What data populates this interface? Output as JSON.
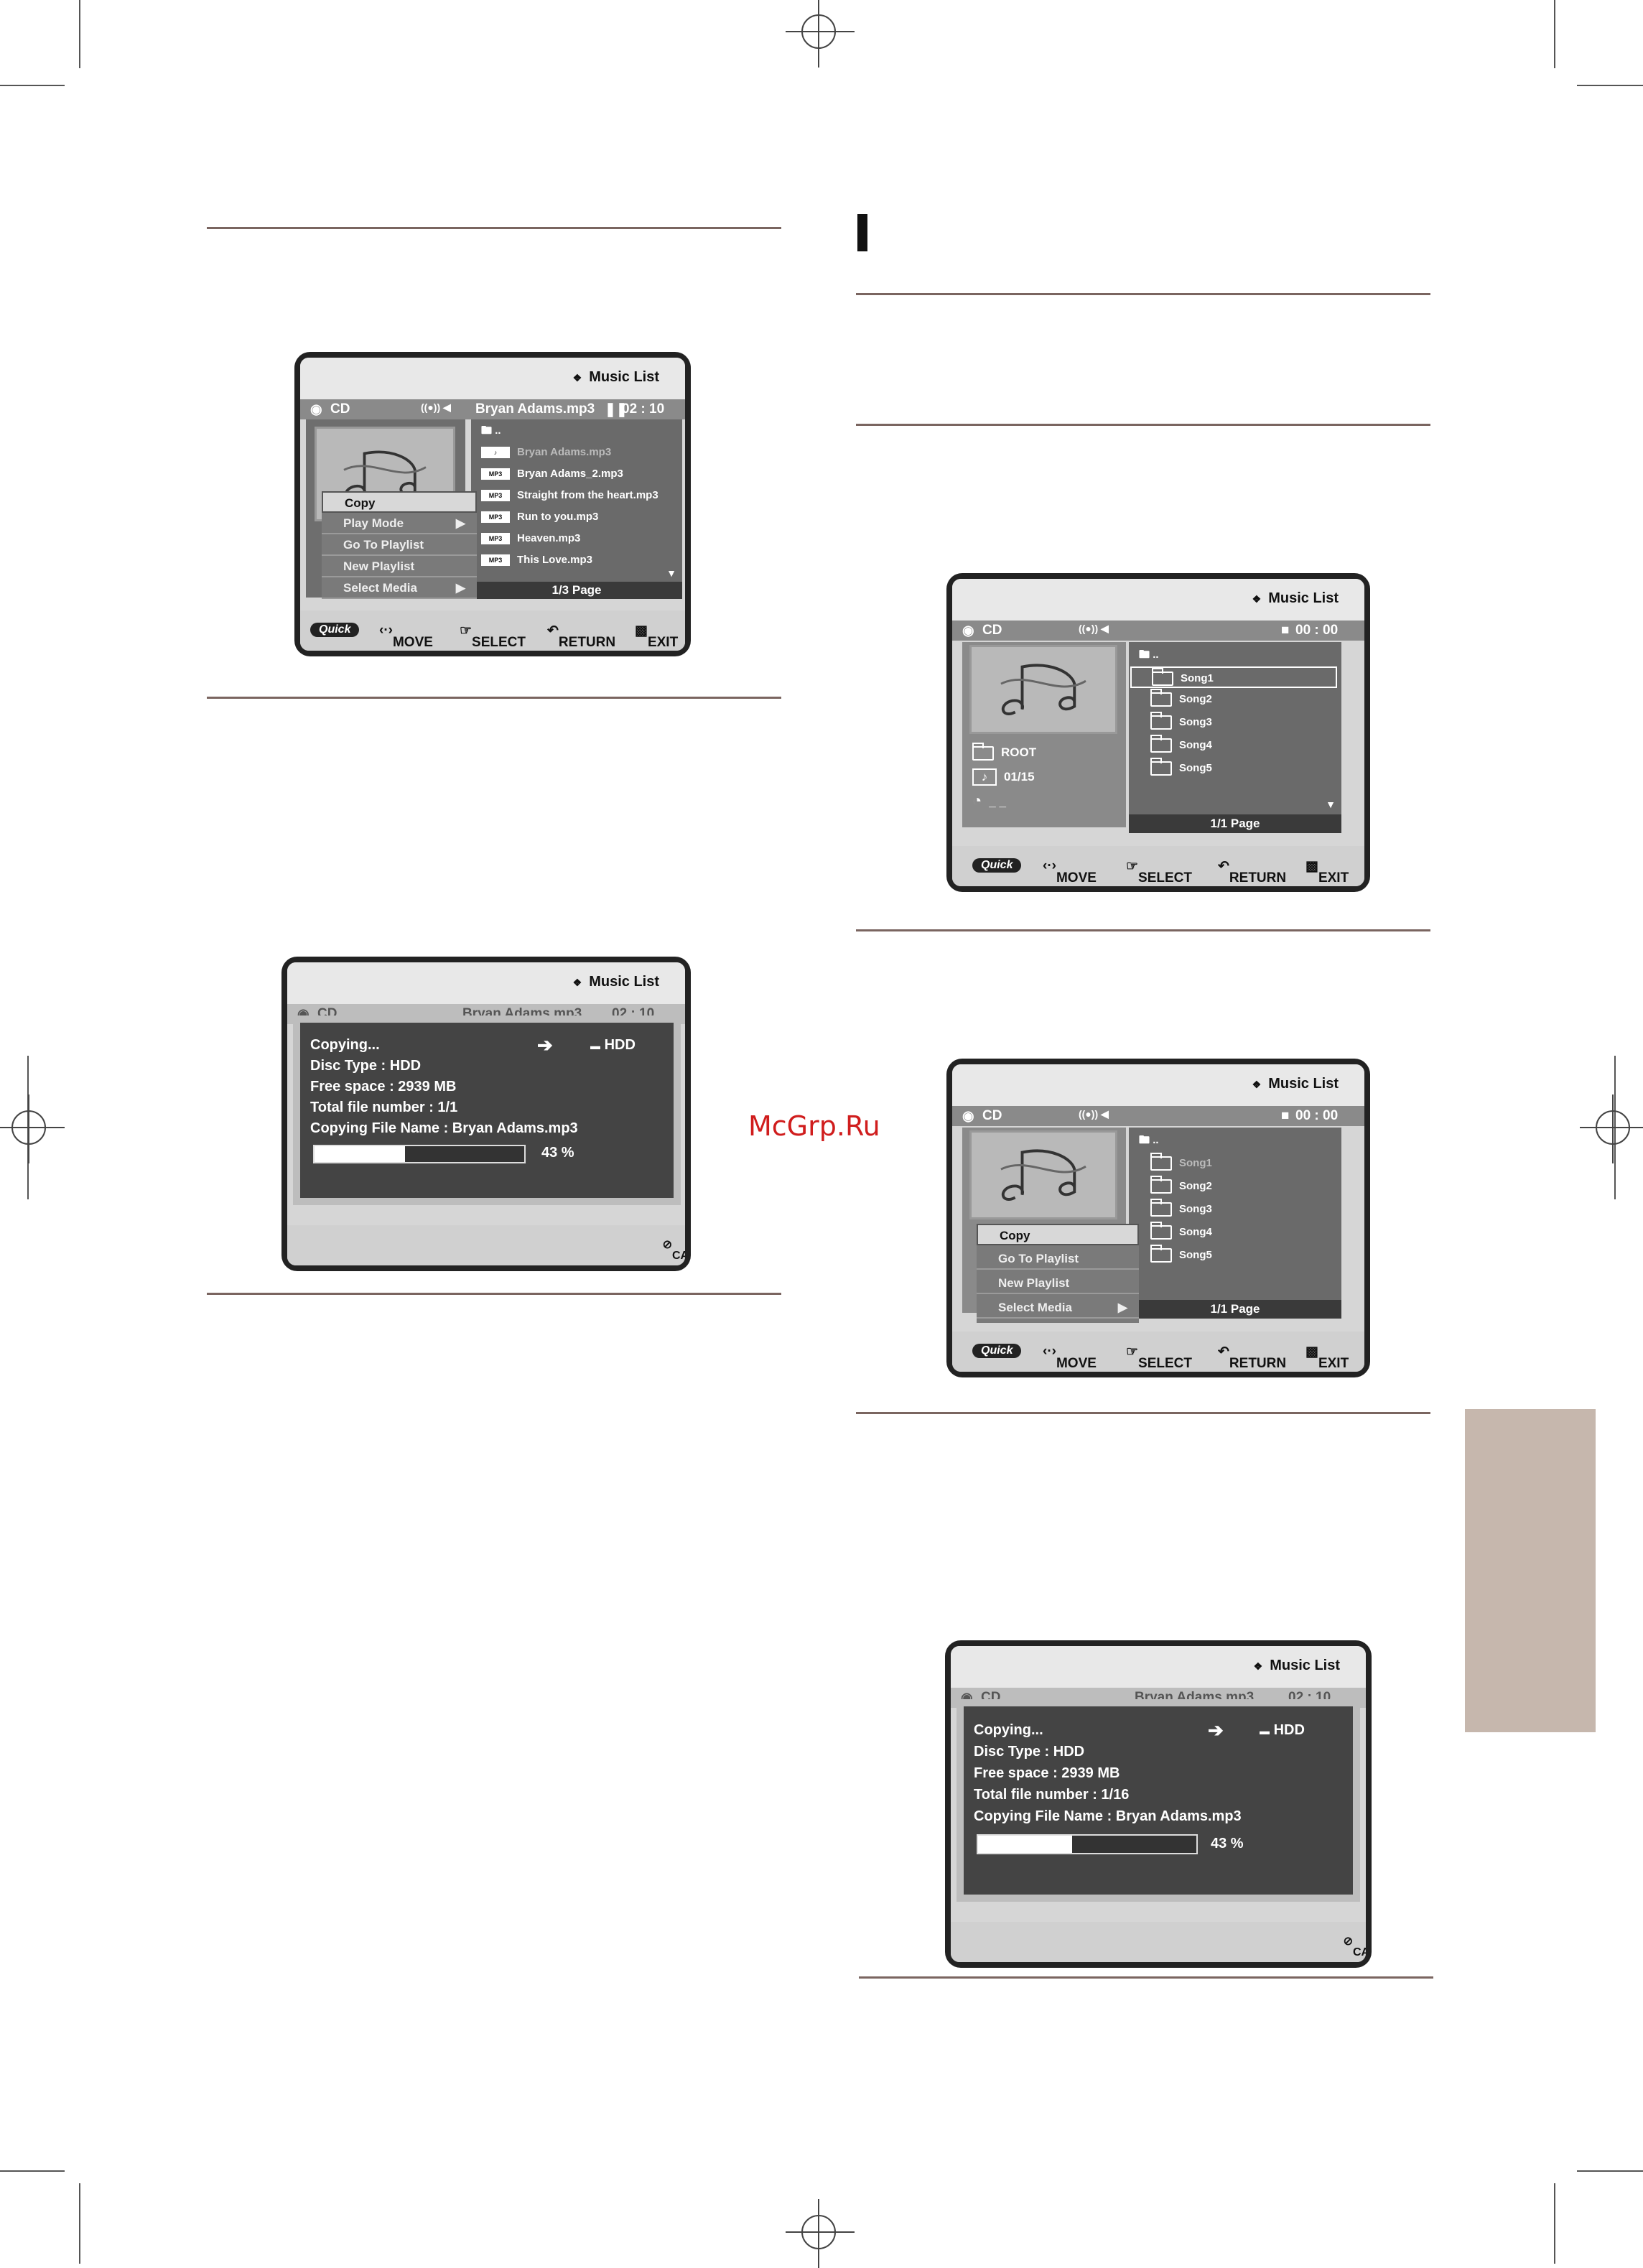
{
  "watermark": "McGrp.Ru",
  "screen1": {
    "title": "Music List",
    "disc": "CD",
    "track": "Bryan Adams.mp3",
    "time": "02 : 10",
    "parent": "..",
    "files": [
      {
        "tag": "♪",
        "name": "Bryan Adams.mp3"
      },
      {
        "tag": "MP3",
        "name": "Bryan Adams_2.mp3"
      },
      {
        "tag": "MP3",
        "name": "Straight from the heart.mp3"
      },
      {
        "tag": "MP3",
        "name": "Run to you.mp3"
      },
      {
        "tag": "MP3",
        "name": "Heaven.mp3"
      },
      {
        "tag": "MP3",
        "name": "This Love.mp3"
      }
    ],
    "menu": [
      "Copy",
      "Play Mode",
      "Go To Playlist",
      "New Playlist",
      "Select Media"
    ],
    "page": "1/3 Page"
  },
  "footer": {
    "quick": "Quick",
    "move": "MOVE",
    "select": "SELECT",
    "return": "RETURN",
    "exit": "EXIT",
    "cancel": "CANCEL"
  },
  "screen2": {
    "title": "Music List",
    "disc": "CD",
    "track": "Bryan Adams.mp3",
    "time": "02 : 10",
    "copying": "Copying...",
    "target": "HDD",
    "disc_type": "Disc Type : HDD",
    "free_space": "Free space : 2939 MB",
    "total_files": "Total file number : 1/1",
    "file_name": "Copying File Name : Bryan Adams.mp3",
    "percent_label": "43 %",
    "progress": 0.43
  },
  "screen3": {
    "title": "Music List",
    "disc": "CD",
    "time": "00 : 00",
    "parent": "..",
    "folders": [
      "Song1",
      "Song2",
      "Song3",
      "Song4",
      "Song5"
    ],
    "root": "ROOT",
    "count": "01/15",
    "clock": "_ _",
    "page": "1/1 Page"
  },
  "screen4": {
    "title": "Music List",
    "disc": "CD",
    "time": "00 : 00",
    "parent": "..",
    "folders": [
      "Song1",
      "Song2",
      "Song3",
      "Song4",
      "Song5"
    ],
    "menu": [
      "Copy",
      "Go To Playlist",
      "New Playlist",
      "Select Media"
    ],
    "page": "1/1 Page"
  },
  "screen5": {
    "title": "Music List",
    "disc": "CD",
    "track": "Bryan Adams.mp3",
    "time": "02 : 10",
    "copying": "Copying...",
    "target": "HDD",
    "disc_type": "Disc Type : HDD",
    "free_space": "Free space : 2939 MB",
    "total_files": "Total file number : 1/16",
    "file_name": "Copying File Name : Bryan Adams.mp3",
    "percent_label": "43 %",
    "progress": 0.43
  }
}
